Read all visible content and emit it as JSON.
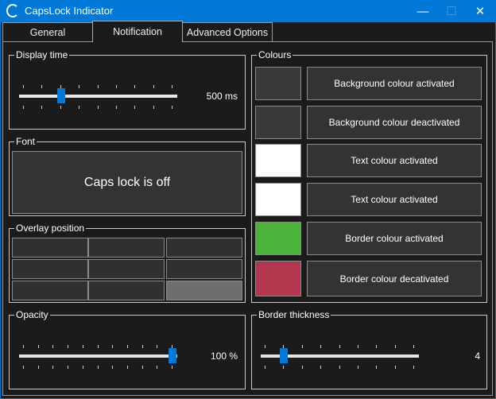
{
  "window": {
    "title": "CapsLock Indicator",
    "minimize": "—",
    "maximize": "☐",
    "close": "✕"
  },
  "tabs": [
    {
      "label": "General",
      "selected": false
    },
    {
      "label": "Notification",
      "selected": true
    },
    {
      "label": "Advanced Options",
      "selected": false
    }
  ],
  "display_time": {
    "label": "Display time",
    "value_text": "500 ms",
    "fraction": 0.25,
    "ticks": 9
  },
  "font": {
    "label": "Font",
    "preview": "Caps lock is off"
  },
  "overlay": {
    "label": "Overlay position",
    "selected_index": 8
  },
  "opacity": {
    "label": "Opacity",
    "value_text": "100 %",
    "fraction": 1.0,
    "ticks": 11
  },
  "colours": {
    "label": "Colours",
    "items": [
      {
        "swatch": "#3a3a3a",
        "button": "Background colour activated"
      },
      {
        "swatch": "#3a3a3a",
        "button": "Background colour deactivated"
      },
      {
        "swatch": "#ffffff",
        "button": "Text colour activated"
      },
      {
        "swatch": "#ffffff",
        "button": "Text colour activated"
      },
      {
        "swatch": "#4cb33a",
        "button": "Border colour activated"
      },
      {
        "swatch": "#b5374f",
        "button": "Border colour decativated"
      }
    ]
  },
  "border_thickness": {
    "label": "Border thickness",
    "value_text": "4",
    "fraction": 0.125,
    "ticks": 9
  }
}
